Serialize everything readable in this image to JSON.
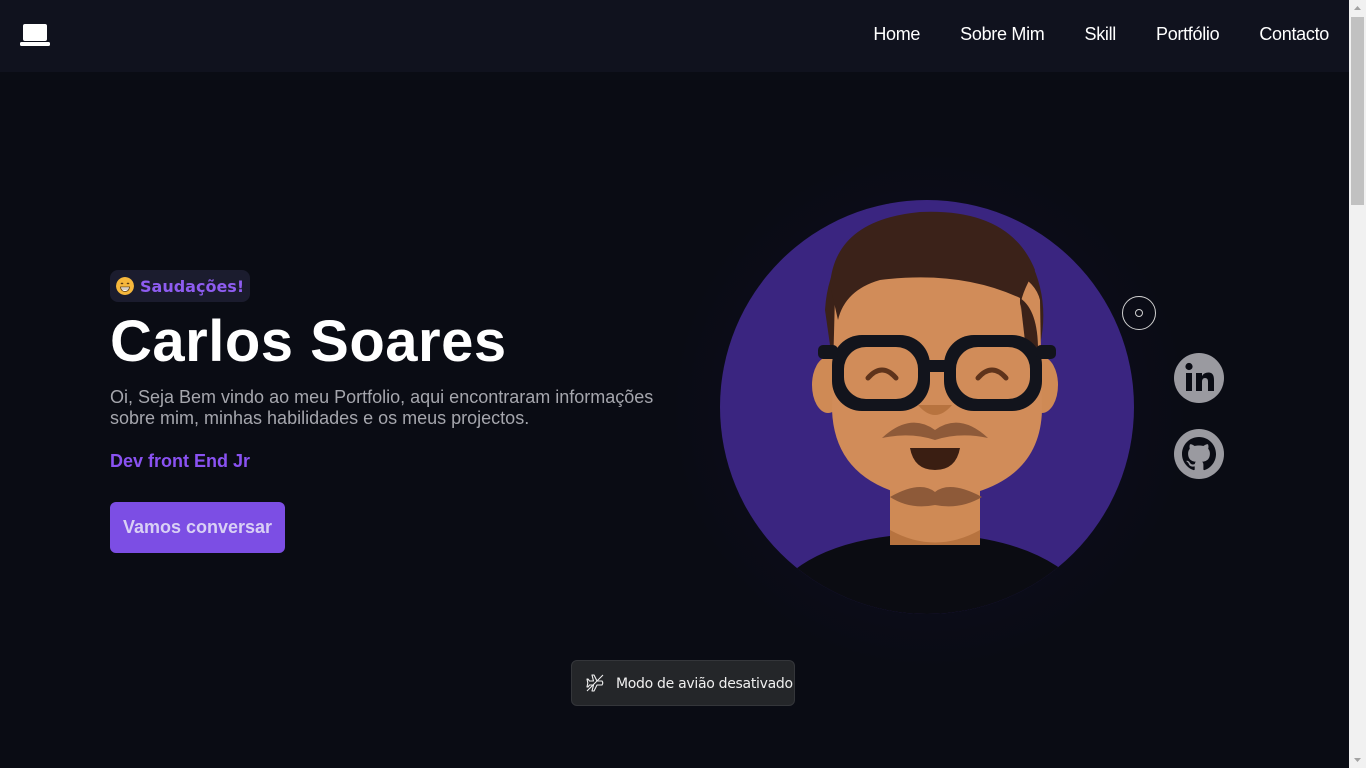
{
  "nav": {
    "logo_icon": "laptop-icon",
    "links": [
      "Home",
      "Sobre Mim",
      "Skill",
      "Portfólio",
      "Contacto"
    ]
  },
  "hero": {
    "greeting_emoji": "grinning-face-icon",
    "greeting": "Saudações!",
    "name": "Carlos Soares",
    "description": "Oi, Seja Bem vindo ao meu Portfolio, aqui encontraram informações sobre mim, minhas habilidades e os meus projectos.",
    "role": "Dev front End Jr",
    "cta": "Vamos conversar"
  },
  "social": {
    "items": [
      "linkedin-icon",
      "github-icon"
    ]
  },
  "toast": {
    "icon": "airplane-icon",
    "text": "Modo de avião desativado"
  },
  "colors": {
    "background": "#0a0c14",
    "navbar": "#10121e",
    "accent": "#7c4ee4",
    "accent_text": "#8a52f2",
    "avatar_circle": "#3a2580"
  }
}
